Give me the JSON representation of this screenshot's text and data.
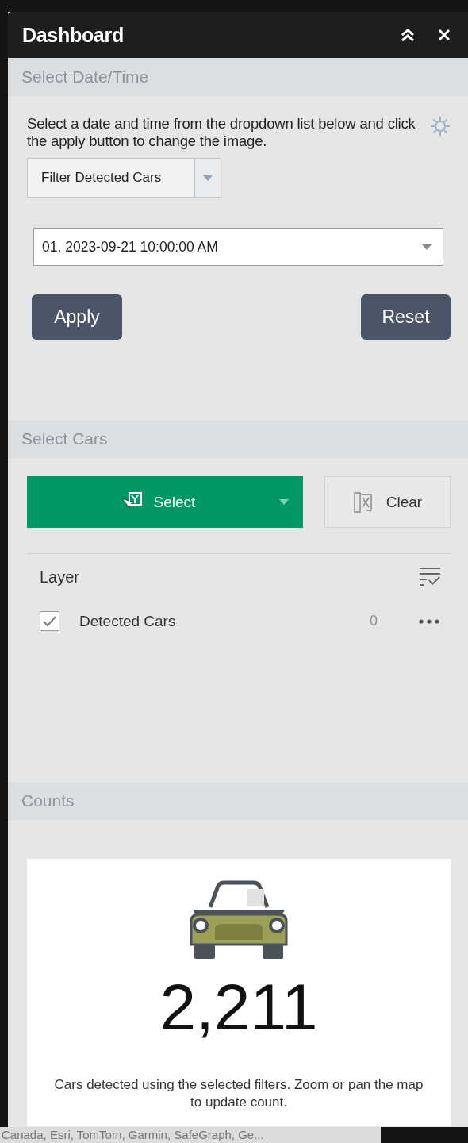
{
  "window": {
    "title": "Dashboard"
  },
  "sections": [
    {
      "kind": "date",
      "title": "Select Date/Time",
      "description": "Select a date and time from the dropdown list below and click the apply button to change the image.",
      "filter": {
        "label": "Filter Detected Cars"
      },
      "date_select": {
        "value": "01. 2023-09-21 10:00:00 AM"
      },
      "buttons": [
        "Apply",
        "Reset"
      ]
    },
    {
      "kind": "select",
      "title": "Select Cars",
      "select_button": "Select",
      "clear_button": "Clear",
      "layer_heading": "Layer",
      "layers": [
        {
          "name": "Detected Cars",
          "checked": true,
          "count": "0"
        }
      ]
    },
    {
      "kind": "counts",
      "title": "Counts",
      "count": "2,211",
      "caption": "Cars detected using the selected filters. Zoom or pan the map to update count."
    }
  ],
  "attribution": "Canada, Esri, TomTom, Garmin, SafeGraph, Ge..."
}
